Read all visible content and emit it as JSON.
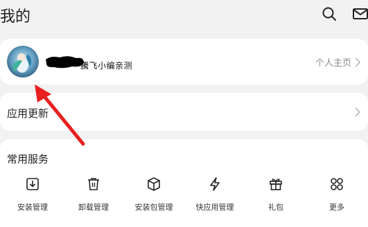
{
  "header": {
    "title": "我的",
    "icons": [
      "search-icon",
      "mail-icon"
    ]
  },
  "profile": {
    "username": "騰飞小编亲测",
    "home_link": "个人主页"
  },
  "update": {
    "label": "应用更新"
  },
  "services": {
    "title": "常用服务",
    "items": [
      {
        "label": "安装管理",
        "icon": "install-icon"
      },
      {
        "label": "卸载管理",
        "icon": "trash-icon"
      },
      {
        "label": "安装包管理",
        "icon": "package-icon"
      },
      {
        "label": "快应用管理",
        "icon": "flash-icon"
      },
      {
        "label": "礼包",
        "icon": "gift-icon"
      },
      {
        "label": "更多",
        "icon": "grid-icon"
      }
    ]
  },
  "colors": {
    "background": "#f2f2f2",
    "card": "#ffffff",
    "annotation": "#e82020",
    "secondary_text": "#8a8a8a"
  }
}
